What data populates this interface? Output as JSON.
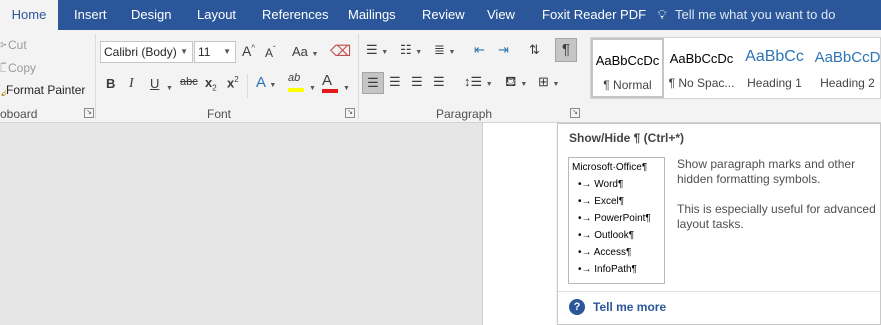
{
  "tabs": [
    {
      "label": "Home",
      "active": true
    },
    {
      "label": "Insert"
    },
    {
      "label": "Design"
    },
    {
      "label": "Layout"
    },
    {
      "label": "References"
    },
    {
      "label": "Mailings"
    },
    {
      "label": "Review"
    },
    {
      "label": "View"
    },
    {
      "label": "Foxit Reader PDF"
    }
  ],
  "tell_me": {
    "icon": "lightbulb-icon",
    "placeholder": "Tell me what you want to do"
  },
  "clipboard": {
    "cut_label": "Cut",
    "copy_label": "Copy",
    "format_painter_label": "Format Painter",
    "group_label": "oboard"
  },
  "font": {
    "font_name": "Calibri (Body)",
    "font_size": "11",
    "group_label": "Font",
    "grow_label": "A",
    "shrink_label": "A",
    "change_case_label": "Aa",
    "bold_label": "B",
    "italic_label": "I",
    "underline_label": "U",
    "strike_label": "abc",
    "subscript_label": "x",
    "subscript_sub": "2",
    "superscript_label": "x",
    "superscript_sup": "2",
    "text_effects_label": "A",
    "font_color_label": "A",
    "highlight_label": "ab",
    "font_color_bar": "#e21a1a",
    "highlight_bar": "#ffff00"
  },
  "paragraph": {
    "group_label": "Paragraph",
    "show_hide_label": "¶"
  },
  "styles": [
    {
      "preview": "AaBbCcDc",
      "name": "¶ Normal",
      "selected": true
    },
    {
      "preview": "AaBbCcDc",
      "name": "¶ No Spac..."
    },
    {
      "preview": "AaBbCc",
      "name": "Heading 1"
    },
    {
      "preview": "AaBbCcD",
      "name": "Heading 2"
    }
  ],
  "tooltip": {
    "title": "Show/Hide ¶ (Ctrl+*)",
    "preview_lines": [
      "Microsoft·Office¶",
      "•→ Word¶",
      "•→ Excel¶",
      "•→ PowerPoint¶",
      "•→ Outlook¶",
      "•→ Access¶",
      "•→ InfoPath¶"
    ],
    "description_1": "Show paragraph marks and other hidden formatting symbols.",
    "description_2": "This is especially useful for advanced layout tasks.",
    "help_icon": "?",
    "tell_me_more": "Tell me more"
  },
  "colors": {
    "accent": "#2b579a",
    "ribbon_bg": "#f3f3f3",
    "heading_blue": "#2e74b5"
  }
}
